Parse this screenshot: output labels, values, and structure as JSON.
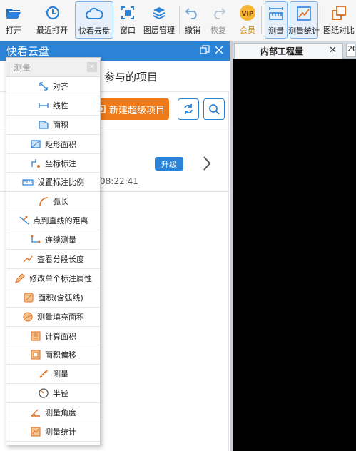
{
  "toolbar": {
    "open": "打开",
    "recent": "最近打开",
    "cloud": "快看云盘",
    "window": "窗口",
    "manage": "图层管理",
    "undo": "撤销",
    "redo": "恢复",
    "vip": "会员",
    "measure": "测量",
    "stats": "测量统计",
    "compare": "图纸对比"
  },
  "panel": {
    "title": "快看云盘",
    "subtitle": "参与的项目",
    "new_project": "新建超级项目",
    "card_time": "08:22:41",
    "card_badge": "升级"
  },
  "doc": {
    "tab_label": "内部工程量",
    "tab_close": "✕",
    "input_value": "20"
  },
  "menu": {
    "title": "测量",
    "items": [
      {
        "label": "对齐",
        "icon": "align-measure-icon"
      },
      {
        "label": "线性",
        "icon": "linear-measure-icon"
      },
      {
        "label": "面积",
        "icon": "area-icon"
      },
      {
        "label": "矩形面积",
        "icon": "rect-area-icon"
      },
      {
        "label": "坐标标注",
        "icon": "coordinate-icon"
      },
      {
        "label": "设置标注比例",
        "icon": "scale-icon"
      },
      {
        "label": "弧长",
        "icon": "arc-length-icon"
      },
      {
        "label": "点到直线的距离",
        "icon": "point-line-distance-icon"
      },
      {
        "label": "连续测量",
        "icon": "continuous-measure-icon"
      },
      {
        "label": "查看分段长度",
        "icon": "segment-length-icon"
      },
      {
        "label": "修改单个标注属性",
        "icon": "edit-annotation-icon"
      },
      {
        "label": "面积(含弧线)",
        "icon": "arc-area-icon"
      },
      {
        "label": "测量填充面积",
        "icon": "fill-area-icon"
      },
      {
        "label": "计算面积",
        "icon": "calc-area-icon"
      },
      {
        "label": "面积偏移",
        "icon": "area-offset-icon"
      },
      {
        "label": "测量",
        "icon": "measure-icon"
      },
      {
        "label": "半径",
        "icon": "radius-icon"
      },
      {
        "label": "测量角度",
        "icon": "angle-icon"
      },
      {
        "label": "测量统计",
        "icon": "measure-stats-icon"
      }
    ]
  },
  "colors": {
    "accent": "#2b83d8",
    "orange": "#ef7a1a",
    "canvas": "#000000"
  }
}
